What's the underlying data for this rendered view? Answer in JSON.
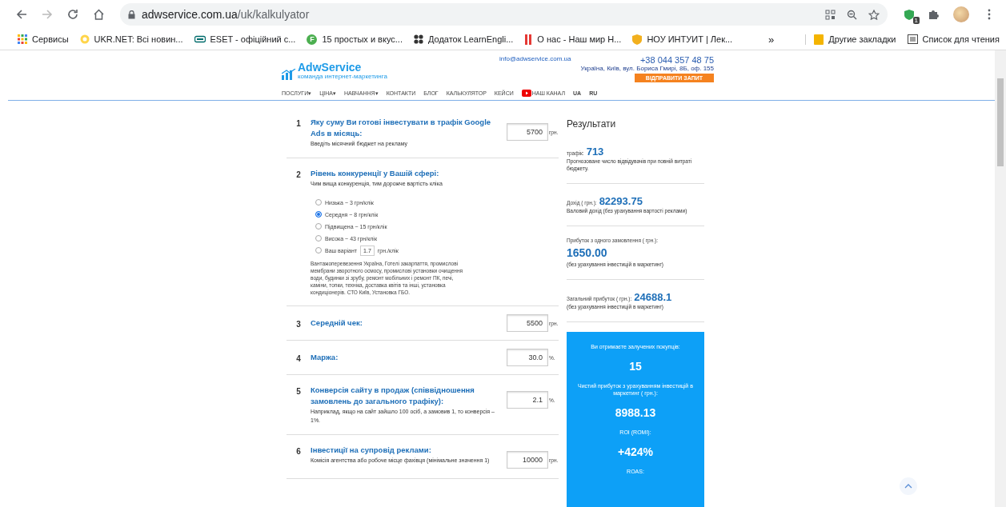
{
  "browser": {
    "url_host": "adwservice.com.ua",
    "url_path": "/uk/kalkulyator",
    "profile_badge": "1"
  },
  "bookmarks": [
    {
      "label": "Сервисы"
    },
    {
      "label": "UKR.NET: Всі новин..."
    },
    {
      "label": "ESET - офіційний с..."
    },
    {
      "label": "15 простых и вкус...",
      "glyph": "F"
    },
    {
      "label": "Додаток LearnEngli..."
    },
    {
      "label": "О нас - Наш мир Н..."
    },
    {
      "label": "НОУ ИНТУИТ | Лек..."
    }
  ],
  "bookmarks_more": "»",
  "bookmarks_right": [
    {
      "label": "Другие закладки"
    },
    {
      "label": "Список для чтения"
    }
  ],
  "site": {
    "logo": "AdwService",
    "logo_sub": "команда интернет-маркетинга",
    "email": "info@adwservice.com.ua",
    "phone": "+38 044 357 48 75",
    "address": "Україна, Київ, вул. Бориса Гмирі, 8Б, оф. 155",
    "cta": "ВІДПРАВИТИ ЗАПИТ",
    "nav": [
      {
        "label": "ПОСЛУГИ",
        "caret": "▾",
        "kind": "menu"
      },
      {
        "label": "ЦІНА",
        "caret": "▾",
        "kind": "menu"
      },
      {
        "label": "НАВЧАННЯ",
        "caret": "▾",
        "kind": "menu"
      },
      {
        "label": "КОНТАКТИ",
        "kind": "link"
      },
      {
        "label": "БЛОГ",
        "kind": "link"
      },
      {
        "label": "КАЛЬКУЛЯТОР",
        "kind": "link"
      },
      {
        "label": "КЕЙСИ",
        "kind": "link"
      },
      {
        "label": "НАШ КАНАЛ",
        "kind": "video"
      },
      {
        "label": "UA",
        "kind": "link"
      },
      {
        "label": "RU",
        "kind": "link"
      }
    ]
  },
  "form": [
    {
      "kind": "input",
      "number": "1",
      "title": "Яку суму Ви готові інвестувати в трафік Google Ads в місяць:",
      "hint": "Введіть місячний бюджет на рекламу",
      "value": "5700",
      "unit": "грн."
    },
    {
      "kind": "choice",
      "number": "2",
      "title": "Рівень конкуренції у Вашій сфері:",
      "hint": "Чим вища конкуренція, тим дорожче вартість кліка",
      "options": [
        {
          "kind": "fixed",
          "label": "Низька ~ 3 грн/клік",
          "selected": false
        },
        {
          "kind": "fixed",
          "label": "Середня ~ 8 грн/клік",
          "selected": true
        },
        {
          "kind": "fixed",
          "label": "Підвищена ~ 15 грн/клік",
          "selected": false
        },
        {
          "kind": "fixed",
          "label": "Висока ~ 43 грн/клік",
          "selected": false
        },
        {
          "kind": "custom",
          "label": "Ваш варіант",
          "value": "1.7",
          "unit": "грн./клік",
          "selected": false
        }
      ],
      "note": "Вантажоперевезення Україна, Готелі закарпаття, промислові мембрани зворотного осмосу, промислові установки очищення води, будинки зі зрубу, ремонт мобільних і ремонт ПК, печі, каміни, топки, техніка, доставка квітів та інші, установка кондиціонерів. СТО Київ, Установка ГБО."
    },
    {
      "kind": "input",
      "number": "3",
      "title": "Середній чек:",
      "value": "5500",
      "unit": "грн."
    },
    {
      "kind": "input",
      "number": "4",
      "title": "Маржа:",
      "value": "30.0",
      "unit": "%."
    },
    {
      "kind": "input",
      "number": "5",
      "title": "Конверсія сайту в продаж (співвідношення замовлень до загального трафіку):",
      "hint": "Наприклад, якщо на сайт зайшло 100 осіб, а замовив 1, то конверсія – 1%.",
      "value": "2.1",
      "unit": "%."
    },
    {
      "kind": "input",
      "number": "6",
      "title": "Інвестиції на супровід реклами:",
      "hint": "Комісія агентства або робоче місце фахівця (мінімальне значення 1)",
      "value": "10000",
      "unit": "грн."
    }
  ],
  "results": {
    "title": "Результати",
    "items": [
      {
        "kind": "inline",
        "label": "трафік:",
        "value": "713",
        "note": "Прогнозоване число відвідувачів при повній витраті бюджету."
      },
      {
        "kind": "inline",
        "label": "Дохід ( грн.):",
        "value": "82293.75",
        "note": "Валовий дохід (без урахування вартості реклами)"
      },
      {
        "kind": "block",
        "label": "Прибуток з одного замовлення ( грн.):",
        "value": "1650.00",
        "note": "(без урахування інвестицій в маркетинг)"
      },
      {
        "kind": "inline",
        "label": "Загальний прибуток ( грн.):",
        "value": "24688.1",
        "note": "(без урахування інвестицій в маркетинг)"
      }
    ],
    "summary": [
      {
        "label": "Ви отримаєте залучених покупців:",
        "value": "15"
      },
      {
        "label": "Чистий прибуток з урахуванням інвестицій в маркетинг ( грн.):",
        "value": "8988.13"
      },
      {
        "label": "ROI (ROMI):",
        "value": "+424%"
      },
      {
        "label": "ROAS:"
      }
    ]
  }
}
